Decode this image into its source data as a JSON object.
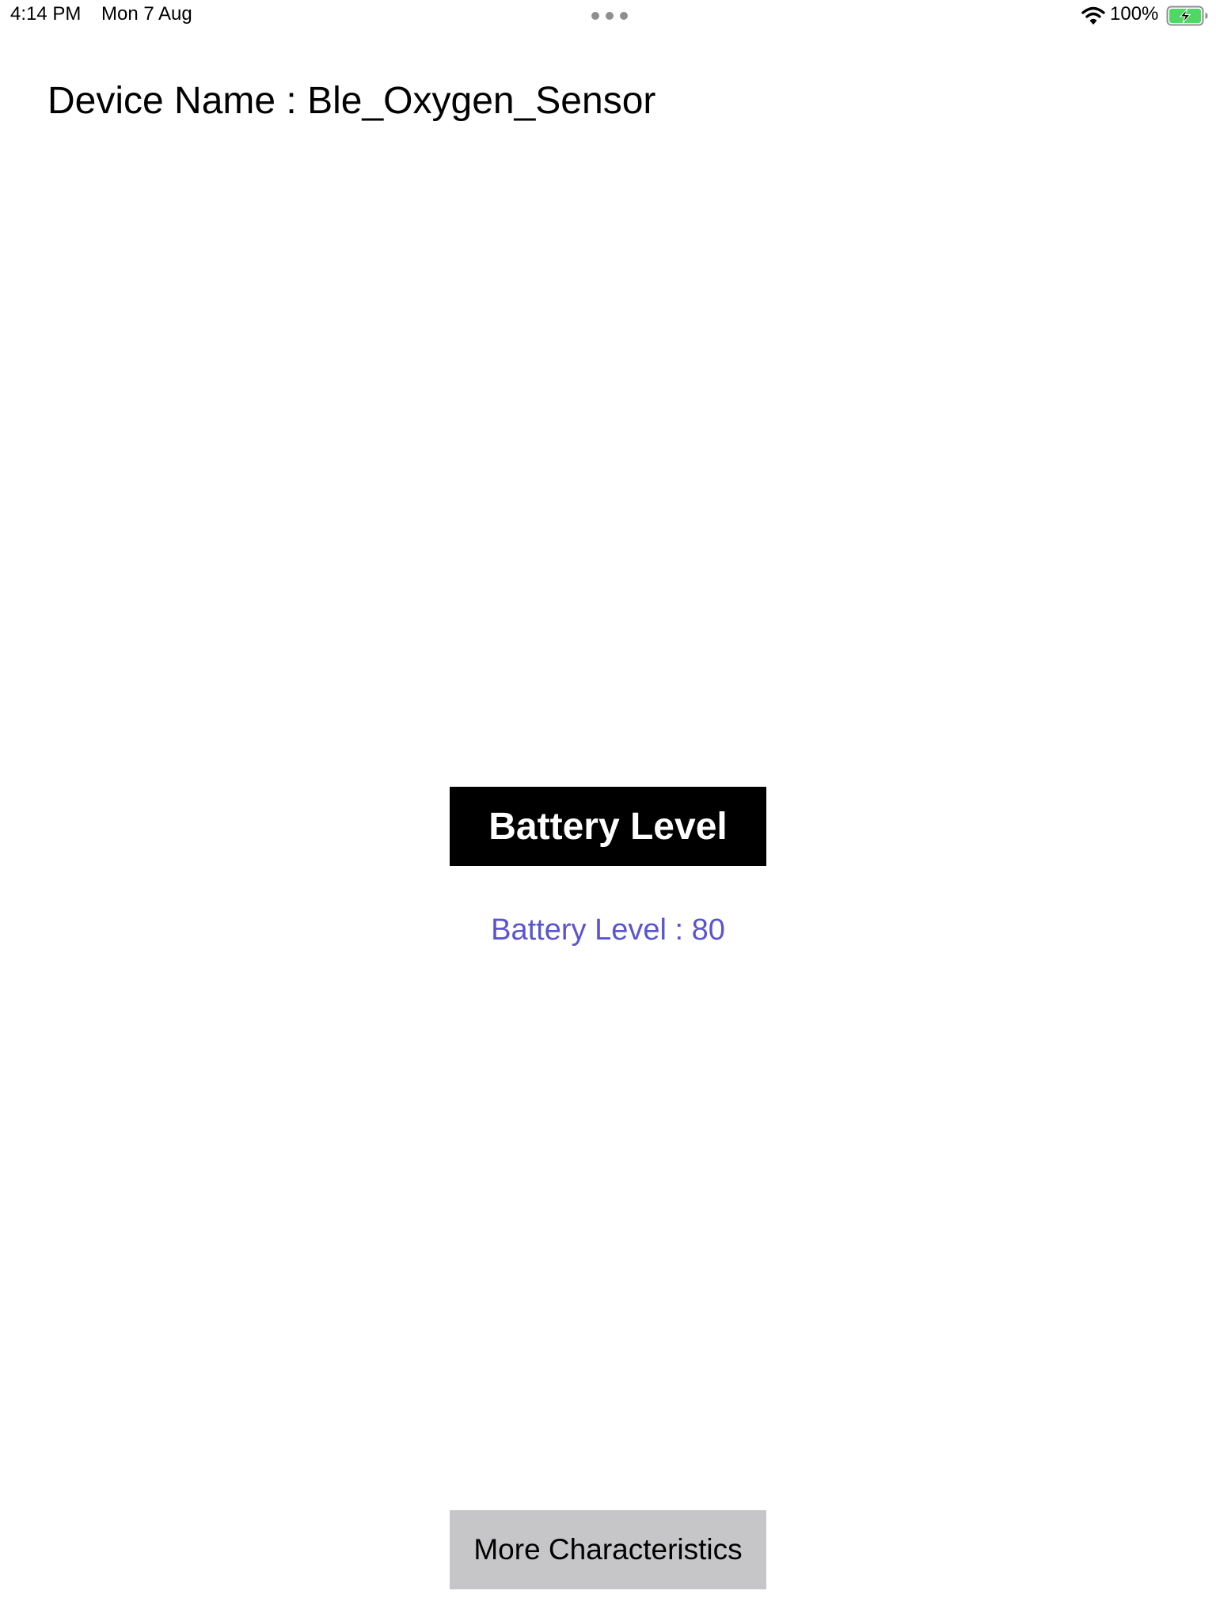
{
  "status_bar": {
    "time": "4:14 PM",
    "date": "Mon 7 Aug",
    "battery_percent": "100%",
    "icons": [
      "wifi-icon",
      "battery-charging-icon",
      "multitask-dots-icon"
    ]
  },
  "header": {
    "device_name": "Device Name : Ble_Oxygen_Sensor"
  },
  "main": {
    "battery_button_label": "Battery Level",
    "battery_readout": "Battery Level : 80",
    "more_button_label": "More Characteristics"
  },
  "colors": {
    "battery_button_bg": "#000000",
    "readout_text": "#5a55cf",
    "more_button_bg": "#c6c6c8",
    "battery_fill": "#4cd964"
  }
}
